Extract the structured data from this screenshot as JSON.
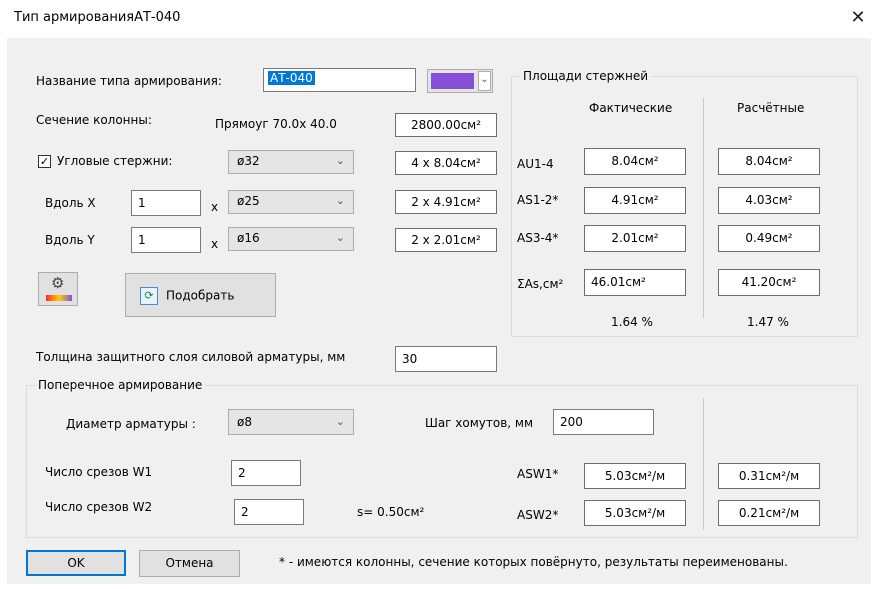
{
  "window": {
    "title": "Тип армированияАТ-040",
    "close_glyph": "✕"
  },
  "left": {
    "type_name_label": "Название типа армирования:",
    "type_name_value": "АТ-040",
    "color_swatch": "#8a4fd8",
    "section_label": "Сечение колонны:",
    "section_value": "Прямоуг 70.0x 40.0",
    "section_area": "2800.00см²",
    "corner_checked_glyph": "✓",
    "corner_label": "Угловые стержни:",
    "corner_diameter": "ø32",
    "corner_area": "4 x 8.04см²",
    "along_x_label": "Вдоль X",
    "along_x_count": "1",
    "along_x_times": "x",
    "along_x_diameter": "ø25",
    "along_x_area": "2 x 4.91см²",
    "along_y_label": "Вдоль Y",
    "along_y_count": "1",
    "along_y_times": "x",
    "along_y_diameter": "ø16",
    "along_y_area": "2 x 2.01см²",
    "settings_icon_glyph": "⚙",
    "select_button_icon": "⟳",
    "select_button_label": "Подобрать",
    "cover_label": "Толщина защитного слоя силовой арматуры, мм",
    "cover_value": "30"
  },
  "areas_panel": {
    "title": "Площади стержней",
    "col_actual": "Фактические",
    "col_required": "Расчётные",
    "rows": [
      {
        "label": "AU1-4",
        "actual": "8.04см²",
        "required": "8.04см²"
      },
      {
        "label": "AS1-2*",
        "actual": "4.91см²",
        "required": "4.03см²"
      },
      {
        "label": "AS3-4*",
        "actual": "2.01см²",
        "required": "0.49см²"
      },
      {
        "label": "ΣAs,см²",
        "actual": "46.01см²",
        "required": "41.20см²"
      }
    ],
    "pct_actual": "1.64 %",
    "pct_required": "1.47 %"
  },
  "transverse": {
    "title": "Поперечное армирование",
    "diameter_label": "Диаметр арматуры :",
    "diameter_value": "ø8",
    "step_label": "Шаг хомутов, мм",
    "step_value": "200",
    "cuts1_label": "Число срезов W1",
    "cuts1_value": "2",
    "cuts2_label": "Число срезов W2",
    "cuts2_value": "2",
    "s_value": "s= 0.50см²",
    "asw1_label": "ASW1*",
    "asw1_actual": "5.03см²/м",
    "asw1_required": "0.31см²/м",
    "asw2_label": "ASW2*",
    "asw2_actual": "5.03см²/м",
    "asw2_required": "0.21см²/м"
  },
  "footer": {
    "ok": "OK",
    "cancel": "Отмена",
    "note": "* - имеются колонны, сечение которых повёрнуто, результаты переименованы."
  },
  "combo_arrow": "⌄"
}
